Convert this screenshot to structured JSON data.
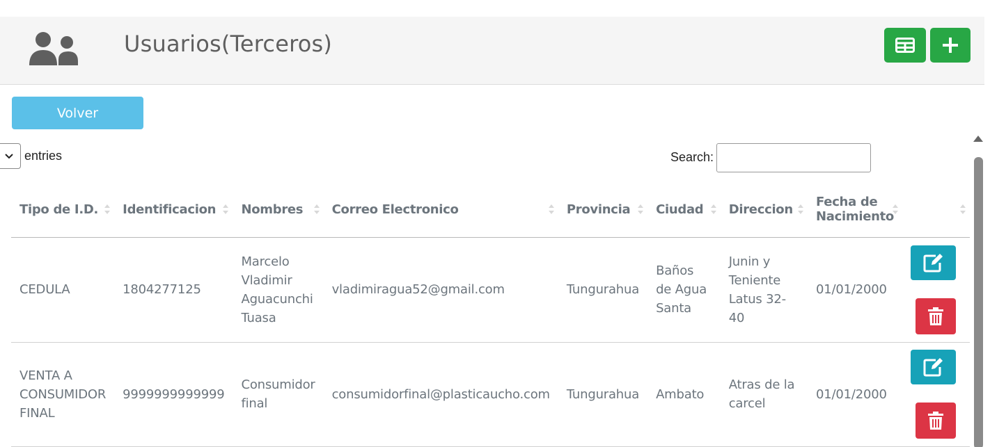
{
  "header": {
    "title": "Usuarios(Terceros)",
    "icon": "users-icon",
    "buttons": [
      {
        "icon": "table-icon",
        "color": "#28a745"
      },
      {
        "icon": "plus-icon",
        "color": "#28a745"
      }
    ]
  },
  "back_button": {
    "label": "Volver",
    "color": "#5bc0e8"
  },
  "table_controls": {
    "entries_label": "entries",
    "search_label": "Search:",
    "search_value": ""
  },
  "table": {
    "columns": [
      "Tipo de I.D.",
      "Identificacion",
      "Nombres",
      "Correo Electronico",
      "Provincia",
      "Ciudad",
      "Direccion",
      "Fecha de Nacimiento",
      ""
    ],
    "rows": [
      {
        "tipo": "CEDULA",
        "identificacion": "1804277125",
        "nombres": "Marcelo Vladimir Aguacunchi Tuasa",
        "correo": "vladimiragua52@gmail.com",
        "provincia": "Tungurahua",
        "ciudad": "Baños de Agua Santa",
        "direccion": "Junin y Teniente Latus 32-40",
        "fecha": "01/01/2000"
      },
      {
        "tipo": "VENTA A CONSUMIDOR FINAL",
        "identificacion": "9999999999999",
        "nombres": "Consumidor final",
        "correo": "consumidorfinal@plasticaucho.com",
        "provincia": "Tungurahua",
        "ciudad": "Ambato",
        "direccion": "Atras de la carcel",
        "fecha": "01/01/2000"
      }
    ]
  },
  "colors": {
    "edit": "#17a2b8",
    "delete": "#dc3545"
  }
}
